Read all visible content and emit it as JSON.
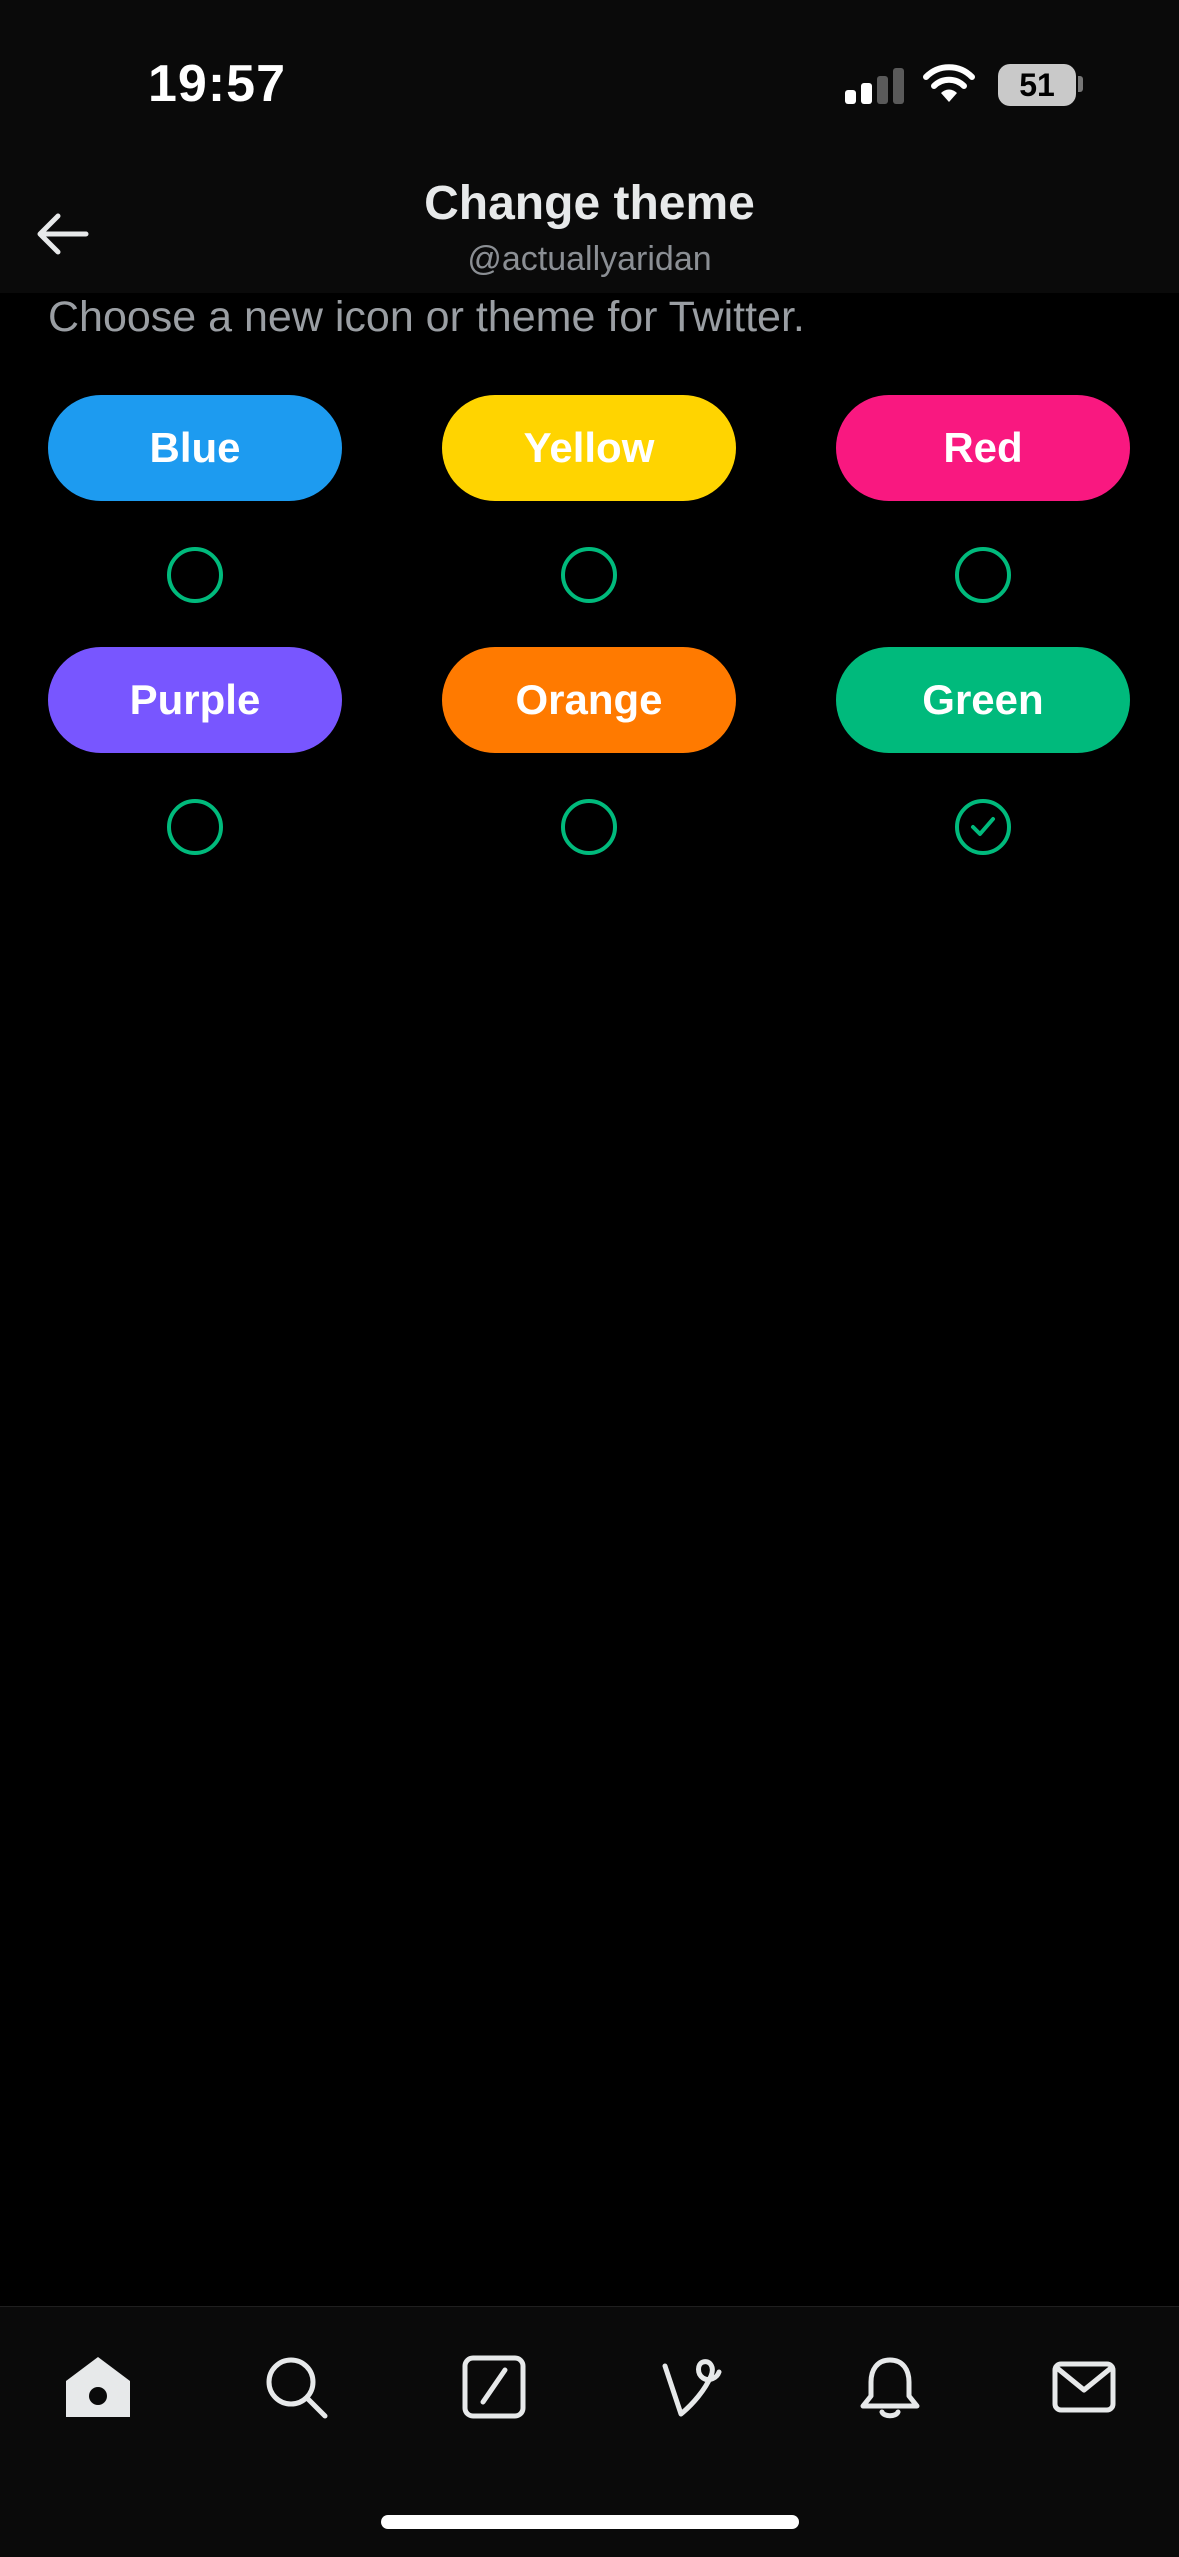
{
  "status_bar": {
    "time": "19:57",
    "battery": "51"
  },
  "header": {
    "title": "Change theme",
    "subtitle": "@actuallyaridan"
  },
  "description": "Choose a new icon or theme for Twitter.",
  "themes": [
    {
      "label": "Blue",
      "color": "#1d9bf0",
      "selected": false
    },
    {
      "label": "Yellow",
      "color": "#ffd400",
      "selected": false
    },
    {
      "label": "Red",
      "color": "#f91880",
      "selected": false
    },
    {
      "label": "Purple",
      "color": "#7856ff",
      "selected": false
    },
    {
      "label": "Orange",
      "color": "#ff7a00",
      "selected": false
    },
    {
      "label": "Green",
      "color": "#00ba7c",
      "selected": true
    }
  ],
  "accent_color": "#00ba7c",
  "tab_bar": {
    "tabs": [
      {
        "icon": "home-icon"
      },
      {
        "icon": "search-icon"
      },
      {
        "icon": "compose-icon"
      },
      {
        "icon": "vine-icon"
      },
      {
        "icon": "bell-icon"
      },
      {
        "icon": "mail-icon"
      }
    ]
  }
}
